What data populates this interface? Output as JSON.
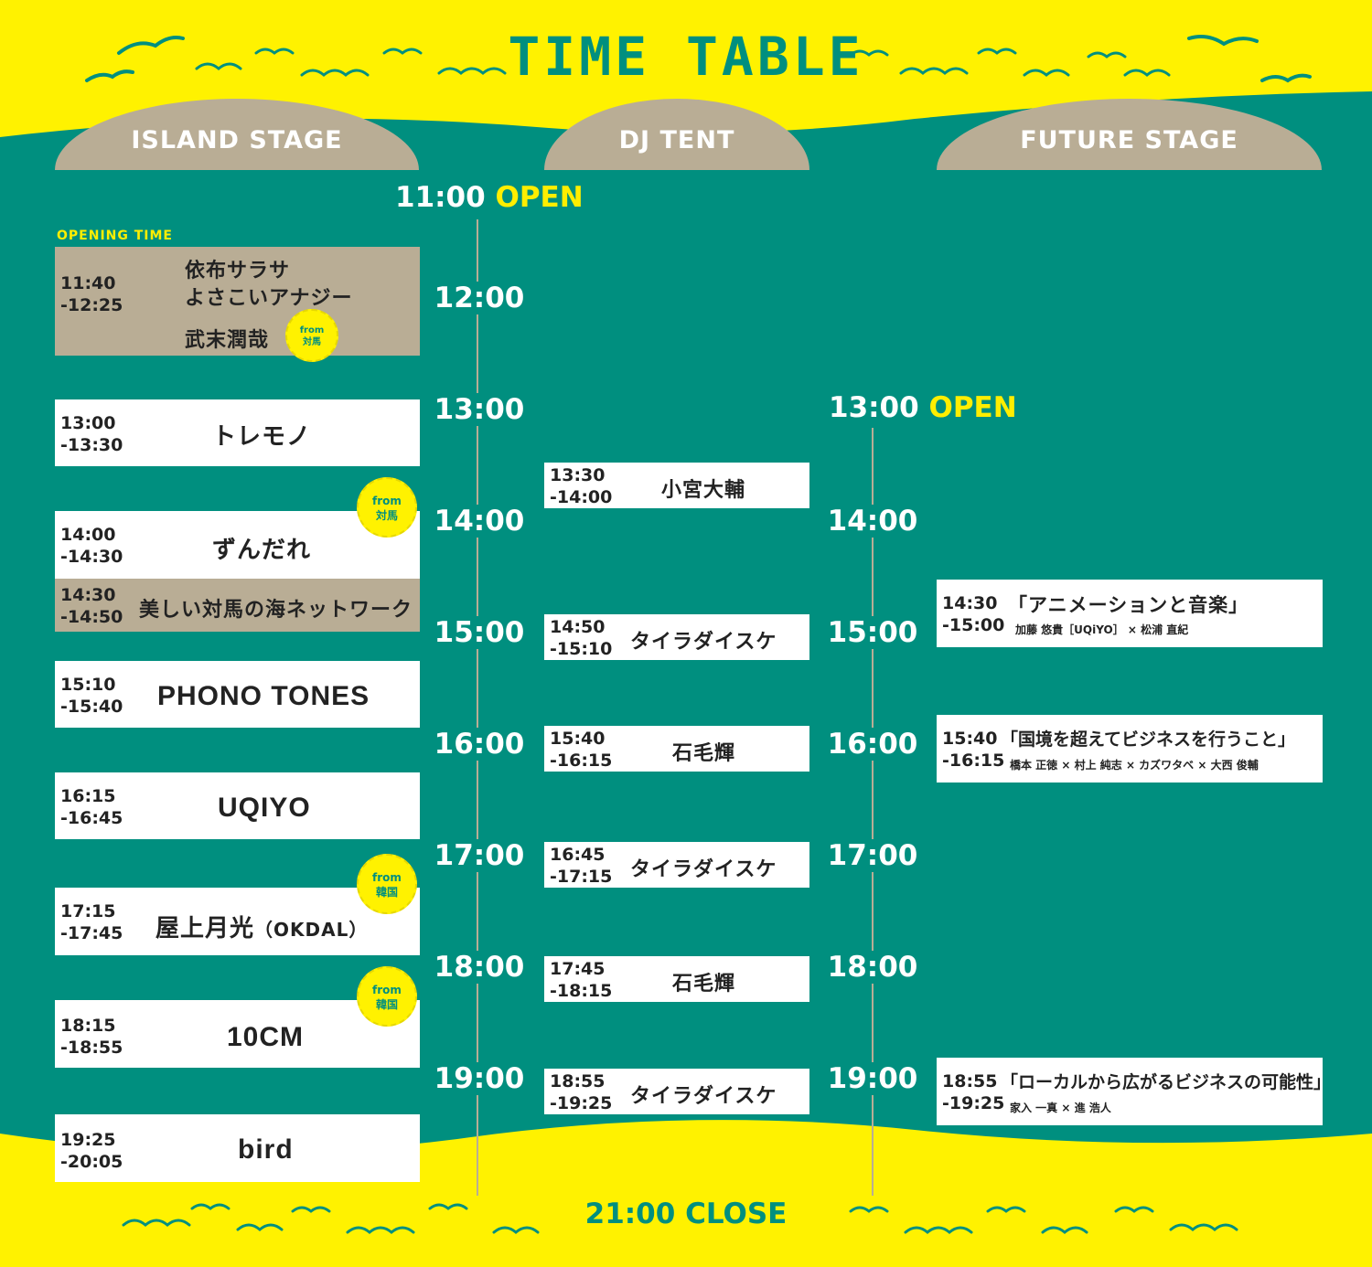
{
  "title": "TIME TABLE",
  "colors": {
    "teal": "#008f7f",
    "yellow": "#fff200",
    "tan": "#b9ad95",
    "accent_yellow": "#ffee00"
  },
  "stages": {
    "island": "ISLAND STAGE",
    "dj": "DJ TENT",
    "future": "FUTURE STAGE"
  },
  "open_main": {
    "time": "11:00",
    "label": "OPEN"
  },
  "open_future": {
    "time": "13:00",
    "label": "OPEN"
  },
  "close": "21:00 CLOSE",
  "opening_time_label": "OPENING TIME",
  "hours": [
    "12:00",
    "13:00",
    "14:00",
    "15:00",
    "16:00",
    "17:00",
    "18:00",
    "19:00"
  ],
  "future_hours": [
    "14:00",
    "15:00",
    "16:00",
    "17:00",
    "18:00",
    "19:00"
  ],
  "badge": {
    "from": "from",
    "tsushima": "対馬",
    "korea": "韓国"
  },
  "island": [
    {
      "time": "11:40\n-12:25",
      "lines": [
        "依布サラサ",
        "よさこいアナジー",
        "武末潤哉"
      ]
    },
    {
      "time": "13:00\n-13:30",
      "name": "トレモノ"
    },
    {
      "time": "14:00\n-14:30",
      "name": "ずんだれ"
    },
    {
      "time": "14:30\n-14:50",
      "name": "美しい対馬の海ネットワーク"
    },
    {
      "time": "15:10\n-15:40",
      "name": "PHONO TONES"
    },
    {
      "time": "16:15\n-16:45",
      "name": "UQIYO"
    },
    {
      "time": "17:15\n-17:45",
      "name": "屋上月光",
      "name_sub": "（OKDAL）"
    },
    {
      "time": "18:15\n-18:55",
      "name": "10CM"
    },
    {
      "time": "19:25\n-20:05",
      "name": "bird"
    }
  ],
  "dj": [
    {
      "time": "13:30\n-14:00",
      "name": "小宮大輔"
    },
    {
      "time": "14:50\n-15:10",
      "name": "タイラダイスケ"
    },
    {
      "time": "15:40\n-16:15",
      "name": "石毛輝"
    },
    {
      "time": "16:45\n-17:15",
      "name": "タイラダイスケ"
    },
    {
      "time": "17:45\n-18:15",
      "name": "石毛輝"
    },
    {
      "time": "18:55\n-19:25",
      "name": "タイラダイスケ"
    }
  ],
  "future": [
    {
      "time": "14:30\n-15:00",
      "name": "「アニメーションと音楽」",
      "guests": "加藤 悠貴［UQiYO］ × 松浦 直紀"
    },
    {
      "time": "15:40\n-16:15",
      "name": "「国境を超えてビジネスを行うこと」",
      "guests": "橋本 正徳 × 村上 純志 × カズワタベ × 大西 俊輔"
    },
    {
      "time": "18:55\n-19:25",
      "name": "「ローカルから広がるビジネスの可能性」",
      "guests": "家入 一真 × 進 浩人"
    }
  ]
}
